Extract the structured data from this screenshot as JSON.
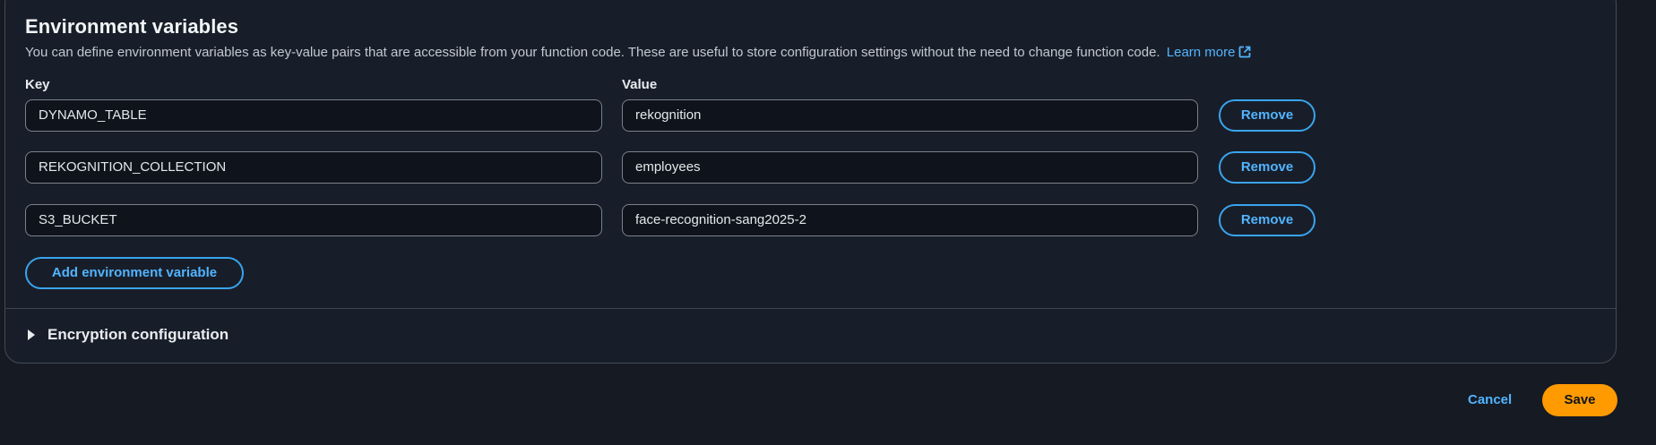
{
  "section": {
    "title": "Environment variables",
    "description": "You can define environment variables as key-value pairs that are accessible from your function code. These are useful to store configuration settings without the need to change function code.",
    "learn_more": "Learn more",
    "key_label": "Key",
    "value_label": "Value"
  },
  "variables": [
    {
      "key": "DYNAMO_TABLE",
      "value": "rekognition",
      "remove_label": "Remove"
    },
    {
      "key": "REKOGNITION_COLLECTION",
      "value": "employees",
      "remove_label": "Remove"
    },
    {
      "key": "S3_BUCKET",
      "value": "face-recognition-sang2025-2",
      "remove_label": "Remove"
    }
  ],
  "add_button": "Add environment variable",
  "encryption": {
    "label": "Encryption configuration",
    "icon": "caret-right-icon"
  },
  "footer": {
    "cancel": "Cancel",
    "save": "Save"
  },
  "colors": {
    "background": "#151a23",
    "panel": "#181e29",
    "accent": "#52b4ff",
    "primary": "#ff9a00"
  }
}
